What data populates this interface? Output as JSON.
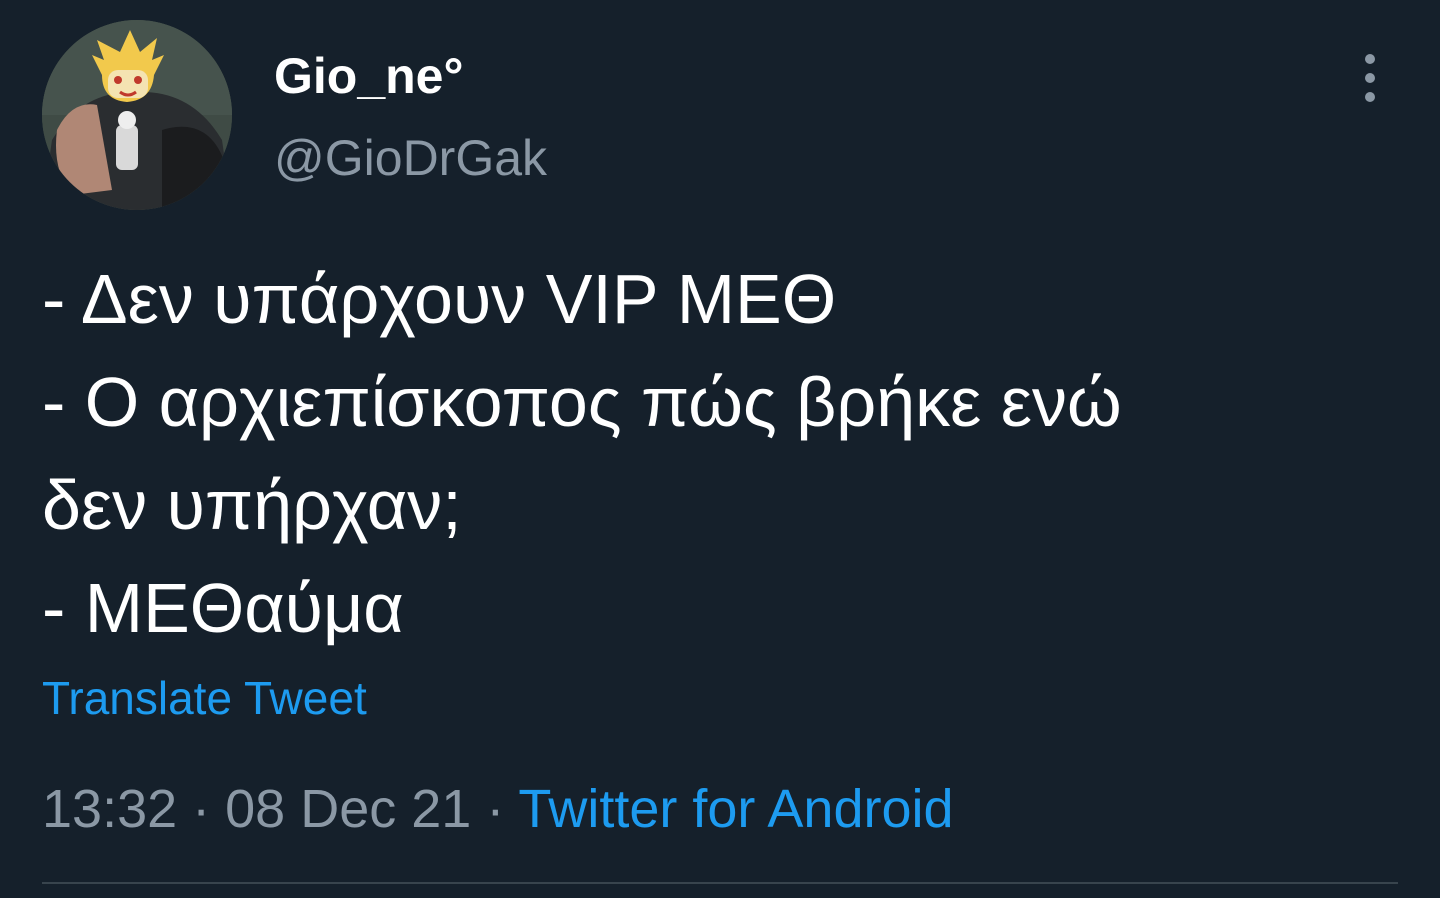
{
  "tweet": {
    "author": {
      "display_name": "Gio_ne°",
      "handle": "@GioDrGak",
      "avatar_icon": "profile-photo"
    },
    "lines": [
      "- Δεν υπάρχουν VIP ΜΕΘ",
      "- Ο αρχιεπίσκοπος πώς βρήκε ενώ",
      "δεν υπήρχαν;",
      "- ΜΕΘαύμα"
    ],
    "translate_label": "Translate Tweet",
    "time": "13:32",
    "separator": " · ",
    "date": "08 Dec 21",
    "source": "Twitter for Android",
    "more_icon": "more-vertical-icon"
  },
  "colors": {
    "background": "#15202b",
    "text_primary": "#ffffff",
    "text_secondary": "#8b98a5",
    "accent": "#1d9bf0",
    "divider": "#38444d"
  }
}
